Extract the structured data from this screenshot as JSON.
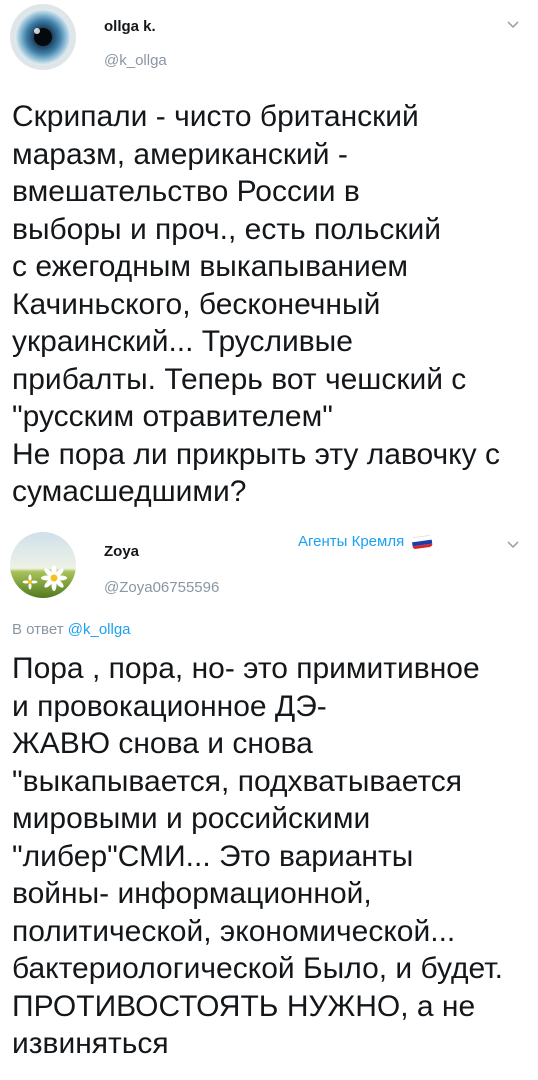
{
  "tweet1": {
    "display_name": "ollga k.",
    "handle": "@k_ollga",
    "lines": [
      "Скрипали - чисто британский",
      "маразм, американский -",
      "вмешательство России в",
      "выборы и проч., есть польский",
      "с ежегодным выкапыванием",
      "Качиньского, бесконечный",
      "украинский... Трусливые",
      "прибалты. Теперь вот чешский с",
      "\"русским отравителем\"",
      "Не пора ли прикрыть эту лавочку с",
      "сумасшедшими?"
    ]
  },
  "tweet2": {
    "display_name": "Zoya",
    "handle": "@Zoya06755596",
    "tag": "Агенты Кремля",
    "reply_prefix": "В ответ",
    "reply_handle": "@k_ollga",
    "lines": [
      "Пора , пора, но- это примитивное",
      "и провокационное ДЭ-",
      "ЖАВЮ снова и снова",
      "\"выкапывается, подхватывается",
      "мировыми и российскими",
      "\"либер\"СМИ... Это варианты",
      "войны- информационной,",
      "политической, экономической...",
      "бактериологической Было, и будет.",
      "ПРОТИВОСТОЯТЬ НУЖНО, а не",
      "извиняться"
    ]
  },
  "icons": {
    "avatar1": "eye-avatar",
    "avatar2": "daisy-field-avatar",
    "chevron": "chevron-down-icon",
    "flag": "russian-flag"
  },
  "colors": {
    "link": "#1ca1f2",
    "muted": "#8a96a2",
    "text": "#14171a"
  }
}
